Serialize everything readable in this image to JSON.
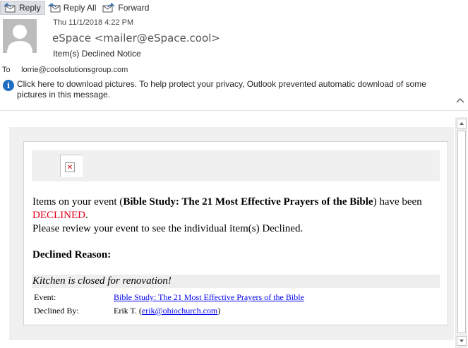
{
  "toolbar": {
    "reply": "Reply",
    "reply_all": "Reply All",
    "forward": "Forward"
  },
  "header": {
    "date": "Thu 11/1/2018 4:22 PM",
    "sender": "eSpace <mailer@eSpace.cool>",
    "subject": "Item(s) Declined Notice",
    "to_label": "To",
    "to_value": "lorrie@coolsolutionsgroup.com",
    "info_message": "Click here to download pictures. To help protect your privacy, Outlook prevented automatic download of some pictures in this message."
  },
  "body": {
    "line1_prefix": "Items on your event (",
    "event_name": "Bible Study: The 21 Most Effective Prayers of the Bible",
    "line1_suffix": ") have been ",
    "status": "DECLINED",
    "line1_end": ".",
    "line2": "Please review your event to see the individual item(s) Declined.",
    "reason_title": "Declined Reason:",
    "reason_text": "Kitchen is closed for renovation!",
    "event_label": "Event:",
    "event_link": "Bible Study: The 21 Most Effective Prayers of the Bible",
    "declined_by_label": "Declined By:",
    "declined_by_name": "Erik T. (",
    "declined_by_email": "erik@ohiochurch.com",
    "declined_by_close": ")"
  },
  "colors": {
    "declined": "#e0001b",
    "link": "#0000ee",
    "info_icon": "#1e6fc1"
  }
}
